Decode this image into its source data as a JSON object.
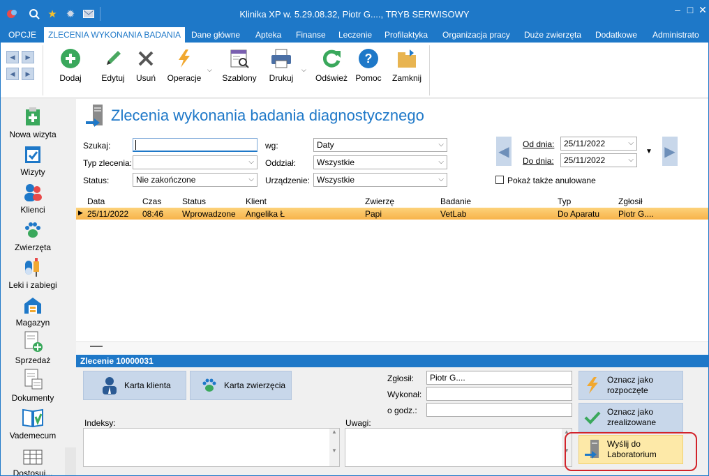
{
  "window": {
    "title": "Klinika XP w. 5.29.08.32, Piotr G...., TRYB SERWISOWY",
    "quick_access": [
      "app-logo-icon",
      "search-icon",
      "star-icon",
      "gear-icon",
      "mail-icon"
    ],
    "controls": {
      "minimize": "–",
      "maximize": "□",
      "close": "✕"
    }
  },
  "tabs": {
    "opcje": "OPCJE",
    "items": [
      "ZLECENIA WYKONANIA BADANIA",
      "Dane główne",
      "Apteka",
      "Finanse",
      "Leczenie",
      "Profilaktyka",
      "Organizacja pracy",
      "Duże zwierzęta",
      "Dodatkowe",
      "Administrato"
    ]
  },
  "ribbon": {
    "dodaj": "Dodaj",
    "edytuj": "Edytuj",
    "usun": "Usuń",
    "operacje": "Operacje",
    "szablony": "Szablony",
    "drukuj": "Drukuj",
    "odswiez": "Odśwież",
    "pomoc": "Pomoc",
    "zamknij": "Zamknij"
  },
  "leftnav": [
    "Nowa wizyta",
    "Wizyty",
    "Klienci",
    "Zwierzęta",
    "Leki i zabiegi",
    "Magazyn",
    "Sprzedaż",
    "Dokumenty",
    "Vademecum",
    "Dostosuj..."
  ],
  "page": {
    "title": "Zlecenia wykonania badania diagnostycznego"
  },
  "filters": {
    "szukaj_label": "Szukaj:",
    "szukaj_value": "",
    "typ_label": "Typ zlecenia:",
    "typ_value": "",
    "status_label": "Status:",
    "status_value": "Nie zakończone",
    "wg_label": "wg:",
    "wg_value": "Daty",
    "oddzial_label": "Oddział:",
    "oddzial_value": "Wszystkie",
    "urzadzenie_label": "Urządzenie:",
    "urzadzenie_value": "Wszystkie",
    "od_label": "Od dnia:",
    "od_value": "25/11/2022",
    "do_label": "Do dnia:",
    "do_value": "25/11/2022",
    "anulowane_label": "Pokaż także anulowane"
  },
  "grid": {
    "columns": [
      "Data",
      "Czas",
      "Status",
      "Klient",
      "Zwierzę",
      "Badanie",
      "Typ",
      "Zgłosił"
    ],
    "rows": [
      [
        "25/11/2022",
        "08:46",
        "Wprowadzone",
        "Angelika Ł",
        "Papi",
        "VetLab",
        "Do Aparatu",
        "Piotr G...."
      ]
    ]
  },
  "detail": {
    "title": "Zlecenie 10000031",
    "karta_klienta": "Karta klienta",
    "karta_zwierzecia": "Karta zwierzęcia",
    "zglosil_label": "Zgłosił:",
    "zglosil_value": "Piotr G....",
    "wykonal_label": "Wykonał:",
    "wykonal_value": "",
    "godz_label": "o godz.:",
    "godz_value": "",
    "indeksy_label": "Indeksy:",
    "uwagi_label": "Uwagi:",
    "rozpoczete": "Oznacz jako rozpoczęte",
    "zrealizowane": "Oznacz jako zrealizowane",
    "wyslij": "Wyślij do Laboratorium"
  },
  "colors": {
    "accent": "#1e78c8",
    "selected_row": "#f7b34a",
    "highlight": "#d2232a"
  }
}
